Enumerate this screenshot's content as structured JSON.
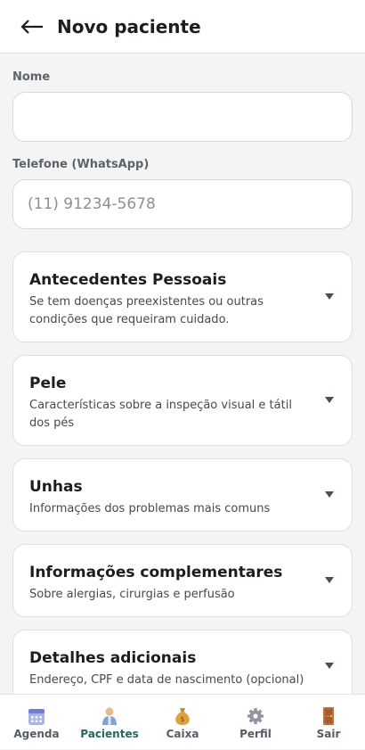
{
  "header": {
    "back_icon": "arrow-left-icon",
    "title": "Novo paciente"
  },
  "form": {
    "name_label": "Nome",
    "name_value": "",
    "phone_label": "Telefone (WhatsApp)",
    "phone_placeholder": "(11) 91234-5678"
  },
  "sections": [
    {
      "title": "Antecedentes Pessoais",
      "desc": "Se tem doenças preexistentes ou outras condições que requeiram cuidado.",
      "icon": "chevron-down-icon"
    },
    {
      "title": "Pele",
      "desc": "Características sobre a inspeção visual e tátil dos pés",
      "icon": "chevron-down-icon"
    },
    {
      "title": "Unhas",
      "desc": "Informações dos problemas mais comuns",
      "icon": "chevron-down-icon"
    },
    {
      "title": "Informações complementares",
      "desc": "Sobre alergias, cirurgias e perfusão",
      "icon": "chevron-down-icon"
    },
    {
      "title": "Detalhes adicionais",
      "desc": "Endereço, CPF e data de nascimento (opcional)",
      "icon": "chevron-down-icon"
    }
  ],
  "nav": [
    {
      "label": "Agenda",
      "icon": "calendar-icon",
      "active": false
    },
    {
      "label": "Pacientes",
      "icon": "person-icon",
      "active": true
    },
    {
      "label": "Caixa",
      "icon": "money-bag-icon",
      "active": false
    },
    {
      "label": "Perfil",
      "icon": "gear-icon",
      "active": false
    },
    {
      "label": "Sair",
      "icon": "door-icon",
      "active": false
    }
  ],
  "colors": {
    "accent": "#1f6b5e",
    "background": "#f4f4f5",
    "card_border": "#dcdee2"
  }
}
